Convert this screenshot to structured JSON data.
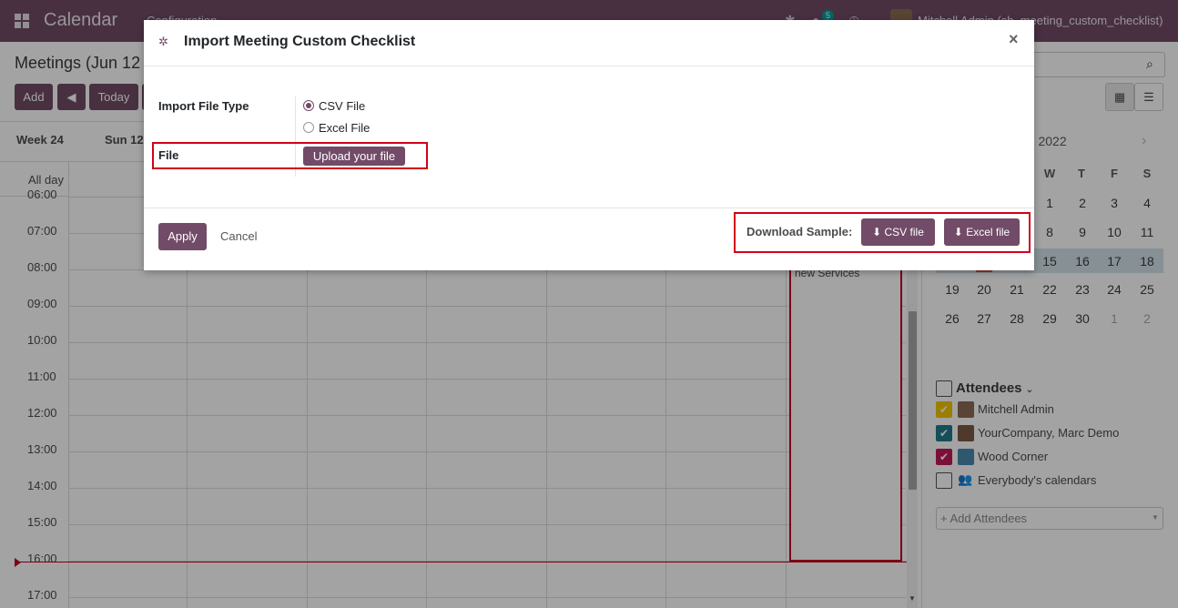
{
  "navbar": {
    "app_title": "Calendar",
    "menu_item": "Configuration",
    "badge_count": "5",
    "user_name": "Mitchell Admin (sh_meeting_custom_checklist)"
  },
  "control_panel": {
    "page_title": "Meetings (Jun 12",
    "add_label": "Add",
    "today_label": "Today"
  },
  "calendar": {
    "week_label": "Week 24",
    "first_day_label": "Sun 12",
    "allday_label": "All day",
    "time_labels": [
      "06:00",
      "07:00",
      "08:00",
      "09:00",
      "10:00",
      "11:00",
      "12:00",
      "13:00",
      "14:00",
      "15:00",
      "16:00",
      "17:00"
    ],
    "event_text": "new Services"
  },
  "sidebar": {
    "month_label": "un 2022",
    "weekdays": [
      "W",
      "T",
      "F",
      "S"
    ],
    "weeks": [
      [
        "1",
        "2",
        "3",
        "4"
      ],
      [
        "8",
        "9",
        "10",
        "11"
      ],
      [
        "15",
        "16",
        "17",
        "18"
      ],
      [
        "19",
        "20",
        "21",
        "22",
        "23",
        "24",
        "25"
      ],
      [
        "26",
        "27",
        "28",
        "29",
        "30",
        "1",
        "2"
      ]
    ],
    "attendees_title": "Attendees",
    "attendees": [
      {
        "name": "Mitchell Admin",
        "color": "#f2c500"
      },
      {
        "name": "YourCompany, Marc Demo",
        "color": "#1f7a8c"
      },
      {
        "name": "Wood Corner",
        "color": "#c2185b"
      },
      {
        "name": "Everybody's calendars",
        "color": ""
      }
    ],
    "add_attendees_placeholder": "+ Add Attendees"
  },
  "modal": {
    "title": "Import Meeting Custom Checklist",
    "close_glyph": "×",
    "file_type_label": "Import File Type",
    "csv_option": "CSV File",
    "excel_option": "Excel File",
    "selected_option": "CSV File",
    "file_label": "File",
    "upload_label": "Upload your file",
    "apply_label": "Apply",
    "cancel_label": "Cancel",
    "download_sample_label": "Download Sample:",
    "csv_sample_label": "CSV file",
    "excel_sample_label": "Excel file"
  },
  "colors": {
    "brand": "#714b67",
    "highlight_box": "#d0021b",
    "week_highlight": "#d4e2e9"
  }
}
